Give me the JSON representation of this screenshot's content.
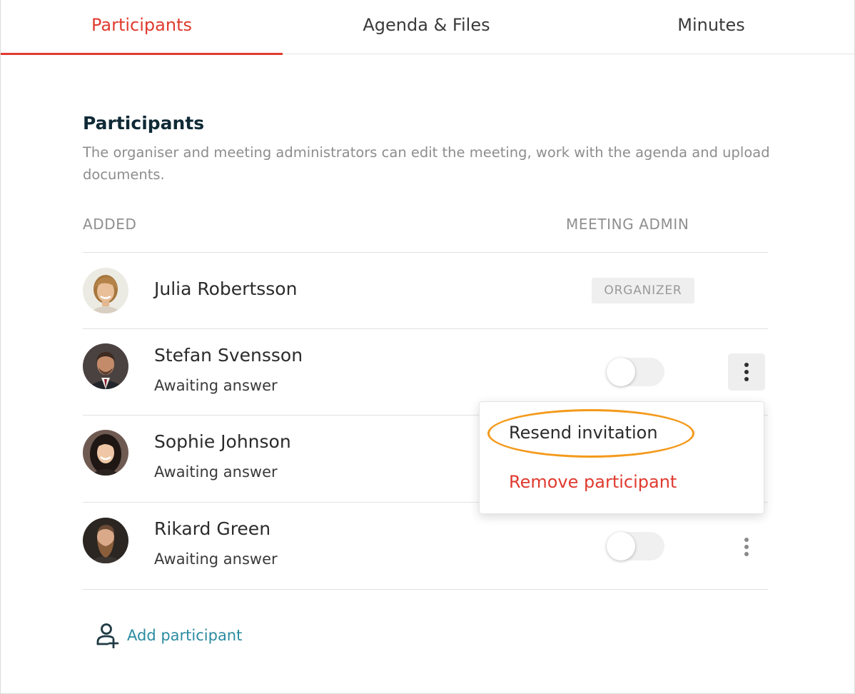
{
  "tabs": [
    {
      "label": "Participants",
      "active": true
    },
    {
      "label": "Agenda & Files",
      "active": false
    },
    {
      "label": "Minutes",
      "active": false
    }
  ],
  "section": {
    "title": "Participants",
    "description": "The organiser and meeting administrators can edit the meeting, work with the agenda and upload documents."
  },
  "columns": {
    "added": "ADDED",
    "meeting_admin": "MEETING ADMIN"
  },
  "participants": [
    {
      "name": "Julia Robertsson",
      "status": "",
      "badge": "ORGANIZER",
      "admin": false
    },
    {
      "name": "Stefan Svensson",
      "status": "Awaiting answer",
      "admin": false
    },
    {
      "name": "Sophie Johnson",
      "status": "Awaiting answer",
      "admin": false
    },
    {
      "name": "Rikard Green",
      "status": "Awaiting answer",
      "admin": false
    }
  ],
  "context_menu": {
    "items": [
      {
        "label": "Resend invitation"
      },
      {
        "label": "Remove participant"
      }
    ]
  },
  "add_participant": {
    "label": "Add participant",
    "icon": "add-person-icon"
  },
  "colors": {
    "accent": "#e03a2f",
    "title": "#0f2a36",
    "link": "#2b8ba0",
    "highlight": "#f49a1b"
  }
}
